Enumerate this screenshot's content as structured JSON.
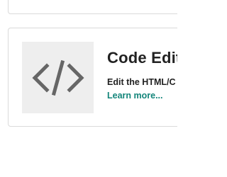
{
  "cards": {
    "code_editor": {
      "icon": "code-brackets-icon",
      "title": "Code Edit",
      "description": "Edit the HTML/C",
      "link_label": "Learn more..."
    }
  },
  "colors": {
    "link": "#13857a",
    "thumb_bg": "#eeeeee",
    "icon": "#666666",
    "text": "#222222",
    "border": "#dadada"
  }
}
